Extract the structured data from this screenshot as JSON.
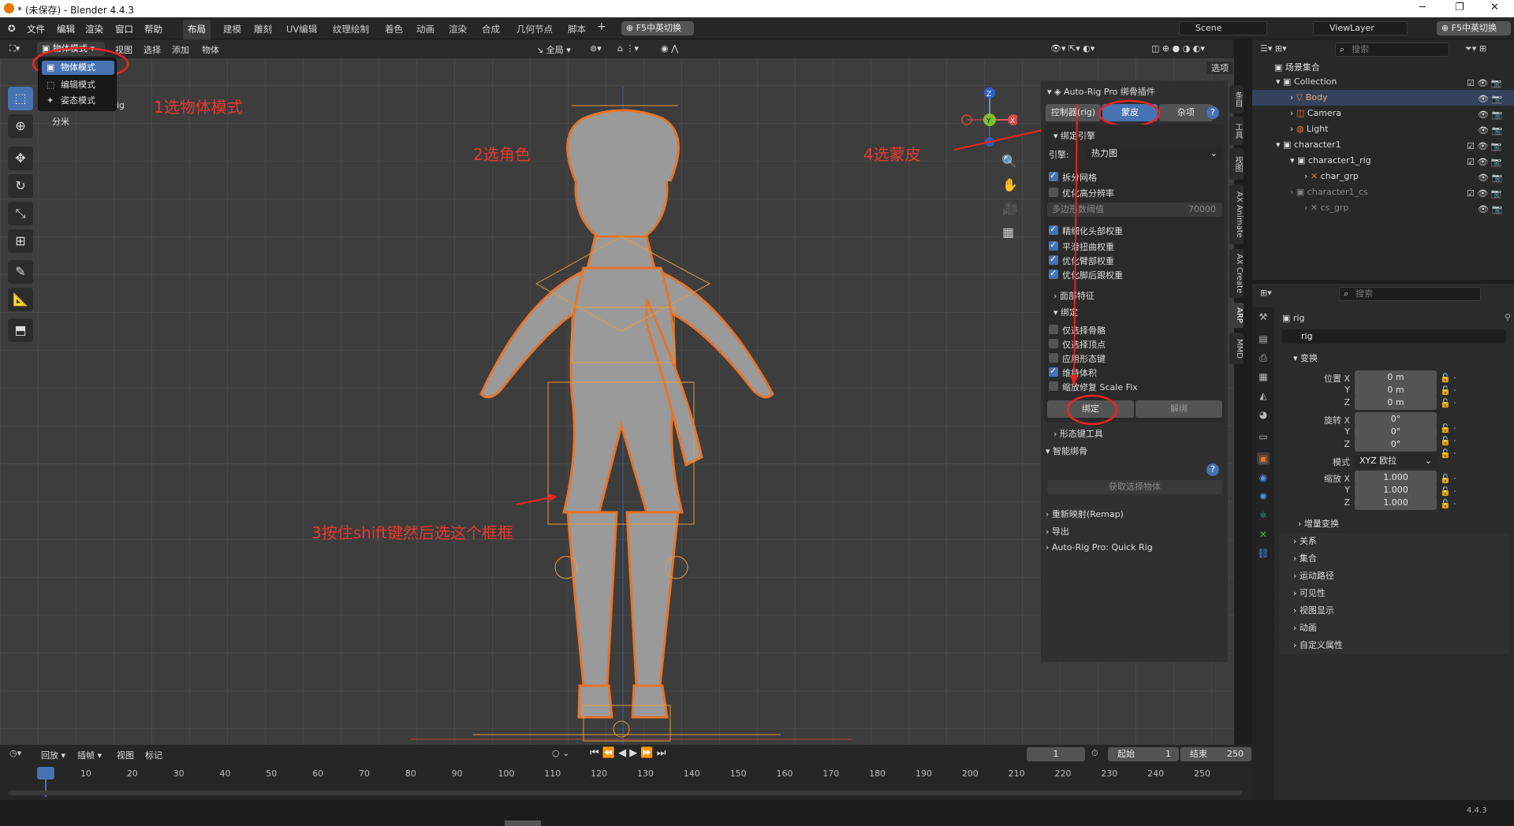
{
  "window": {
    "title": "* (未保存) - Blender 4.4.3"
  },
  "menu": [
    "文件",
    "编辑",
    "渲染",
    "窗口",
    "帮助"
  ],
  "workspaces": [
    {
      "label": "布局",
      "active": true
    },
    {
      "label": "建模"
    },
    {
      "label": "雕刻"
    },
    {
      "label": "UV编辑"
    },
    {
      "label": "纹理绘制"
    },
    {
      "label": "着色"
    },
    {
      "label": "动画"
    },
    {
      "label": "渲染"
    },
    {
      "label": "合成"
    },
    {
      "label": "几何节点"
    },
    {
      "label": "脚本"
    }
  ],
  "topbar": {
    "add_tab": "+",
    "ime_toggle": "F5中英切换",
    "scene": "Scene",
    "viewlayer": "ViewLayer",
    "ime_toggle2": "F5中英切换"
  },
  "viewport_header": {
    "mode": "物体模式",
    "view": "视图",
    "select": "选择",
    "add": "添加",
    "object": "物体",
    "transform": "全局",
    "options": "选项"
  },
  "mode_dropdown": {
    "items": [
      "物体模式",
      "编辑模式",
      "姿态模式"
    ]
  },
  "viewport_info": {
    "obj_suffix": "ig",
    "unit": "分米"
  },
  "annotations": {
    "step1": "1选物体模式",
    "step2": "2选角色",
    "step3": "3按住shift键然后选这个框框",
    "step4": "4选蒙皮"
  },
  "gizmo": {
    "z": "Z",
    "y": "Y",
    "x": "X"
  },
  "npanel": {
    "title": "Auto-Rig Pro 绑骨插件",
    "tabs": [
      "控制器(rig)",
      "蒙皮",
      "杂项"
    ],
    "help": "?",
    "bind_engine": "绑定引擎",
    "engine_label": "引擎:",
    "engine_value": "热力图",
    "split_mesh": "拆分网格",
    "optimize_hi": "优化高分辨率",
    "poly_threshold_label": "多边形数阈值",
    "poly_threshold_value": "70000",
    "refine_head": "精细化头部权重",
    "smooth_twist": "平滑扭曲权重",
    "optimize_arm": "优化臂部权重",
    "optimize_heel": "优化脚后跟权重",
    "facial_features": "面部特征",
    "bind_section": "绑定",
    "sel_bones": "仅选择骨骼",
    "sel_verts": "仅选择顶点",
    "apply_shapekeys": "应用形态键",
    "preserve_volume": "维持体积",
    "scale_fix": "缩放修复 Scale Fix",
    "bind_btn": "绑定",
    "unbind_btn": "解绑",
    "shapekey_tools": "形态键工具",
    "smart_rig": "智能绑骨",
    "get_selected": "获取选择物体",
    "remap": "重新映射(Remap)",
    "export": "导出",
    "quick_rig": "Auto-Rig Pro: Quick Rig"
  },
  "side_tabs": [
    "条目",
    "工具",
    "视图",
    "AX Animate",
    "AX Create",
    "ARP",
    "MMD"
  ],
  "outliner": {
    "search_placeholder": "搜索",
    "root": "场景集合",
    "rows": [
      {
        "label": "Collection",
        "indent": 1
      },
      {
        "label": "Body",
        "indent": 2,
        "highlight": true
      },
      {
        "label": "Camera",
        "indent": 2
      },
      {
        "label": "Light",
        "indent": 2
      },
      {
        "label": "character1",
        "indent": 1
      },
      {
        "label": "character1_rig",
        "indent": 2
      },
      {
        "label": "char_grp",
        "indent": 3
      },
      {
        "label": "character1_cs",
        "indent": 2,
        "dim": true
      },
      {
        "label": "cs_grp",
        "indent": 3,
        "dim": true
      }
    ]
  },
  "properties": {
    "search_placeholder": "搜索",
    "object_name": "rig",
    "object_field": "rig",
    "transform": "变换",
    "location_label": "位置 X",
    "loc": [
      "0 m",
      "0 m",
      "0 m"
    ],
    "rotation_label": "旋转 X",
    "rot": [
      "0°",
      "0°",
      "0°"
    ],
    "mode_label": "模式",
    "mode_value": "XYZ 欧拉",
    "scale_label": "缩放 X",
    "scale": [
      "1.000",
      "1.000",
      "1.000"
    ],
    "axis_y": "Y",
    "axis_z": "Z",
    "delta": "增量变换",
    "sections": [
      "关系",
      "集合",
      "运动路径",
      "可见性",
      "视图显示",
      "动画",
      "自定义属性"
    ]
  },
  "timeline": {
    "playback": "回放",
    "keying": "插帧",
    "view": "视图",
    "marker": "标记",
    "current_frame": "1",
    "start_label": "起始",
    "start": "1",
    "end_label": "结束",
    "end": "250",
    "ticks": [
      "1",
      "10",
      "20",
      "30",
      "40",
      "50",
      "60",
      "70",
      "80",
      "90",
      "100",
      "110",
      "120",
      "130",
      "140",
      "150",
      "160",
      "170",
      "180",
      "190",
      "200",
      "210",
      "220",
      "230",
      "240",
      "250"
    ]
  },
  "status": {
    "version": "4.4.3"
  },
  "colors": {
    "accent": "#4772b3",
    "selection": "#e8742a",
    "annotation": "#e8392e"
  }
}
